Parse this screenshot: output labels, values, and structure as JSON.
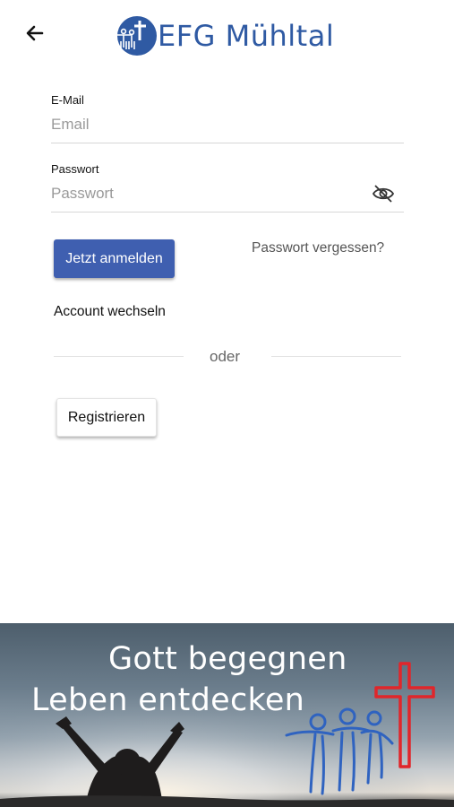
{
  "header": {
    "back_icon": "arrow-left-icon",
    "logo_text": "EFG Mühltal",
    "brand_color": "#2f5aa3"
  },
  "form": {
    "email_label": "E-Mail",
    "email_placeholder": "Email",
    "email_value": "",
    "password_label": "Passwort",
    "password_placeholder": "Passwort",
    "password_value": "",
    "visibility_icon": "eye-off-icon"
  },
  "actions": {
    "login_label": "Jetzt anmelden",
    "forgot_label": "Passwort vergessen?",
    "switch_account_label": "Account wechseln",
    "divider_label": "oder",
    "register_label": "Registrieren",
    "accent_color": "#3f5fb0"
  },
  "banner": {
    "line1": "Gott begegnen",
    "line2": "Leben entdecken",
    "cross_color": "#e0262b",
    "figures_color": "#2f63c0"
  }
}
